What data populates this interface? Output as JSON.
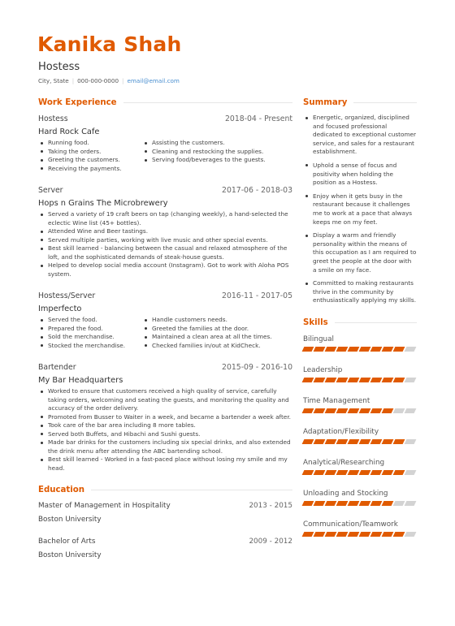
{
  "header": {
    "name": "Kanika Shah",
    "title": "Hostess",
    "location": "City, State",
    "phone": "000-000-0000",
    "email": "email@email.com",
    "separator": "|"
  },
  "colors": {
    "accent": "#e05a00",
    "skill_empty": "#d3d3d3",
    "link": "#4a8fd0"
  },
  "work": {
    "heading": "Work Experience",
    "jobs": [
      {
        "position": "Hostess",
        "dates": "2018-04 - Present",
        "company": "Hard Rock Cafe",
        "layout": "two-col",
        "bullets_left": [
          "Running food.",
          "Taking the orders.",
          "Greeting the customers.",
          "Receiving the payments."
        ],
        "bullets_right": [
          "Assisting the customers.",
          "Cleaning and restocking the supplies.",
          "Serving food/beverages to the guests."
        ]
      },
      {
        "position": "Server",
        "dates": "2017-06 - 2018-03",
        "company": "Hops n Grains The Microbrewery",
        "layout": "one-col",
        "bullets": [
          "Served a variety of 19 craft beers on tap (changing weekly), a hand-selected the eclectic Wine list (45+ bottles).",
          "Attended Wine and Beer tastings.",
          "Served multiple parties, working with live music and other special events.",
          "Best skill learned - balancing between the casual and relaxed atmosphere of the loft, and the sophisticated demands of steak-house guests.",
          "Helped to develop social media account (Instagram). Got to work with Aloha POS system."
        ]
      },
      {
        "position": "Hostess/Server",
        "dates": "2016-11 - 2017-05",
        "company": "Imperfecto",
        "layout": "two-col",
        "bullets_left": [
          "Served the food.",
          "Prepared the food.",
          "Sold the merchandise.",
          "Stocked the merchandise."
        ],
        "bullets_right": [
          "Handle customers needs.",
          "Greeted the families at the door.",
          "Maintained a clean area at all the times.",
          "Checked families in/out at KidCheck."
        ]
      },
      {
        "position": "Bartender",
        "dates": "2015-09 - 2016-10",
        "company": "My Bar Headquarters",
        "layout": "one-col",
        "bullets": [
          "Worked to ensure that customers received a high quality of service, carefully taking orders, welcoming and seating the guests, and monitoring the quality and accuracy of the order delivery.",
          "Promoted from Busser to Waiter in a week, and became a bartender a week after.",
          "Took care of the bar area including 8 more tables.",
          "Served both Buffets, and Hibachi and Sushi guests.",
          "Made bar drinks for the customers including six special drinks, and also extended the drink menu after attending the ABC bartending school.",
          "Best skill learned - Worked in a fast-paced place without losing my smile and my head."
        ]
      }
    ]
  },
  "education": {
    "heading": "Education",
    "items": [
      {
        "degree": "Master of Management in Hospitality",
        "dates": "2013 - 2015",
        "school": "Boston University"
      },
      {
        "degree": "Bachelor of Arts",
        "dates": "2009 - 2012",
        "school": "Boston University"
      }
    ]
  },
  "summary": {
    "heading": "Summary",
    "items": [
      "Energetic, organized, disciplined and focused professional dedicated to exceptional customer service, and sales for a restaurant establishment.",
      "Uphold a sense of focus and positivity when holding the position as a Hostess.",
      "Enjoy when it gets busy in the restaurant because it challenges me to work at a pace that always keeps me on my feet.",
      "Display a warm and friendly personality within the means of this occupation as I am required to greet the people at the door with a smile on my face.",
      "Committed to making restaurants thrive in the community by enthusiastically applying my skills."
    ]
  },
  "skills": {
    "heading": "Skills",
    "scale_max": 10,
    "items": [
      {
        "name": "Bilingual",
        "level": 9
      },
      {
        "name": "Leadership",
        "level": 9
      },
      {
        "name": "Time Management",
        "level": 8
      },
      {
        "name": "Adaptation/Flexibility",
        "level": 9
      },
      {
        "name": "Analytical/Researching",
        "level": 9
      },
      {
        "name": "Unloading and Stocking",
        "level": 8
      },
      {
        "name": "Communication/Teamwork",
        "level": 9
      }
    ]
  }
}
